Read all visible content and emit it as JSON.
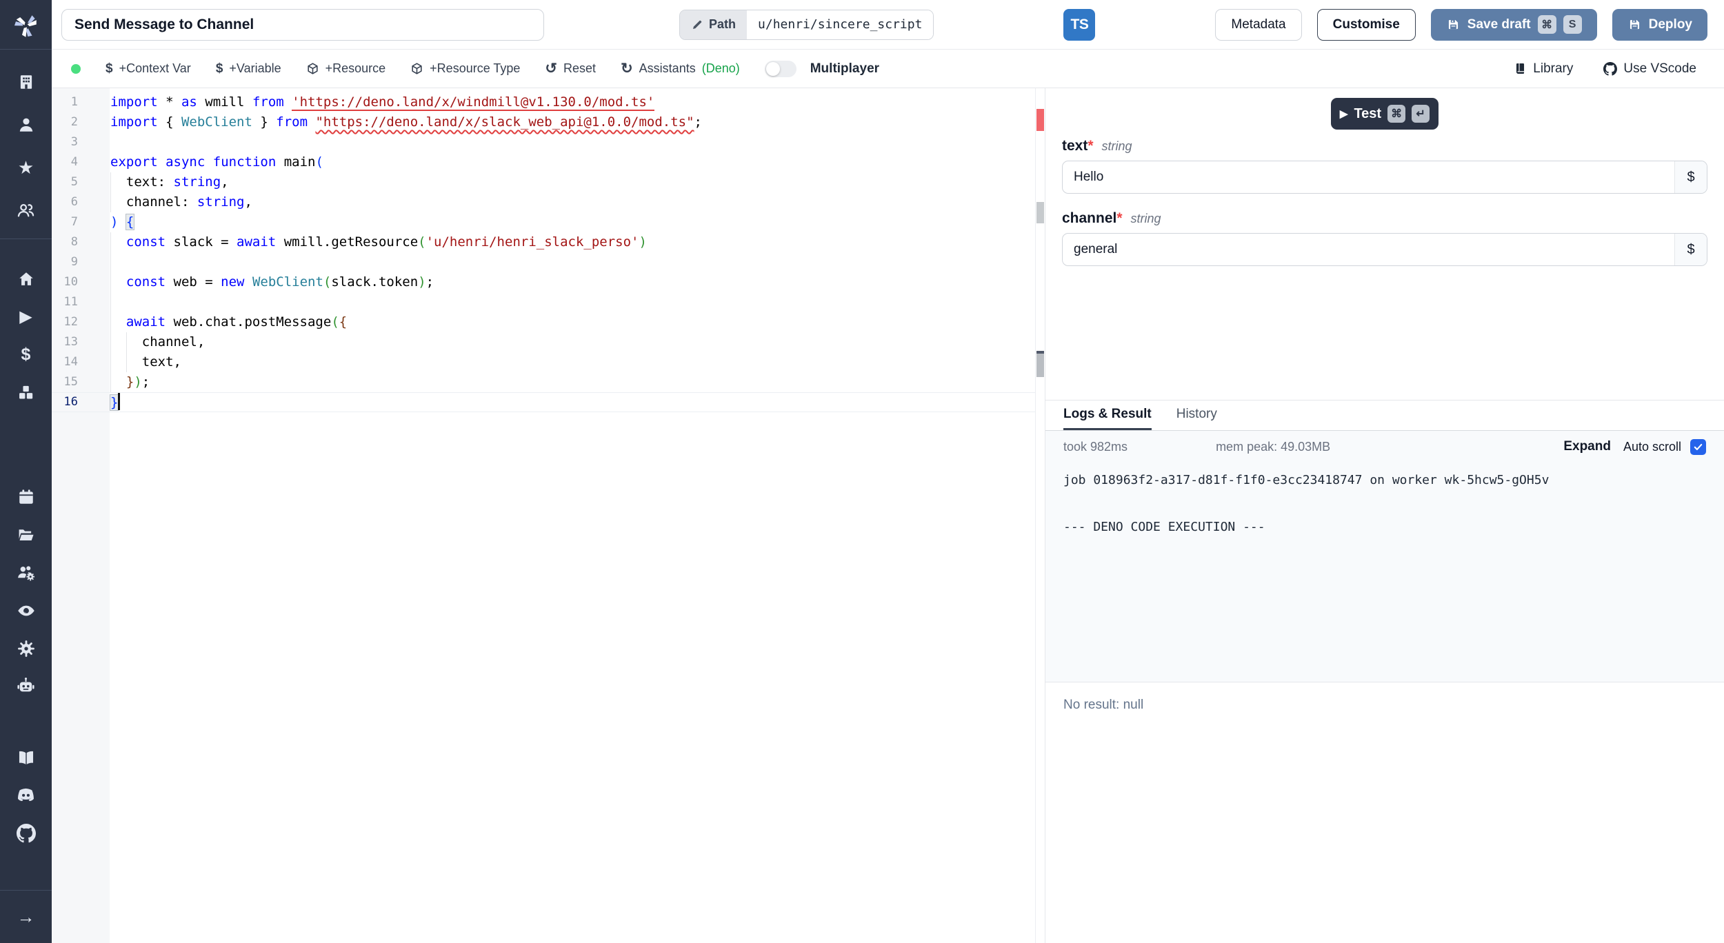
{
  "topbar": {
    "title": "Send Message to Channel",
    "path_label": "Path",
    "path_value": "u/henri/sincere_script",
    "lang_badge": "TS",
    "metadata_label": "Metadata",
    "customise_label": "Customise",
    "save_draft_label": "Save draft",
    "save_shortcut_keys": [
      "⌘",
      "S"
    ],
    "deploy_label": "Deploy"
  },
  "toolbar": {
    "items": [
      {
        "icon": "dollar-icon",
        "glyph": "$",
        "label": "+Context Var"
      },
      {
        "icon": "dollar-icon",
        "glyph": "$",
        "label": "+Variable"
      },
      {
        "icon": "cube-icon",
        "label": "+Resource"
      },
      {
        "icon": "cube-icon",
        "label": "+Resource Type"
      },
      {
        "icon": "reset-icon",
        "glyph": "↺",
        "label": "Reset"
      },
      {
        "icon": "refresh-icon",
        "glyph": "↻",
        "label": "Assistants",
        "suffix": "(Deno)"
      }
    ],
    "multiplayer_label": "Multiplayer",
    "library_label": "Library",
    "vscode_label": "Use VScode"
  },
  "editor": {
    "lines": [
      {
        "num": 1,
        "tokens": [
          [
            "kw",
            "import"
          ],
          [
            "pl",
            " * "
          ],
          [
            "kw",
            "as"
          ],
          [
            "pl",
            " wmill "
          ],
          [
            "kw",
            "from"
          ],
          [
            "pl",
            " "
          ],
          [
            "str errline",
            "'https://deno.land/x/windmill@v1.130.0/mod.ts'"
          ]
        ]
      },
      {
        "num": 2,
        "tokens": [
          [
            "kw",
            "import"
          ],
          [
            "pl",
            " { "
          ],
          [
            "type",
            "WebClient"
          ],
          [
            "pl",
            " } "
          ],
          [
            "kw",
            "from"
          ],
          [
            "pl",
            " "
          ],
          [
            "str errwavy",
            "\"https://deno.land/x/slack_web_api@1.0.0/mod.ts\""
          ],
          [
            "pl",
            ";"
          ]
        ]
      },
      {
        "num": 3,
        "tokens": []
      },
      {
        "num": 4,
        "tokens": [
          [
            "kw",
            "export"
          ],
          [
            "pl",
            " "
          ],
          [
            "kw",
            "async"
          ],
          [
            "pl",
            " "
          ],
          [
            "kw",
            "function"
          ],
          [
            "pl",
            " main"
          ],
          [
            "b1",
            "("
          ]
        ]
      },
      {
        "num": 5,
        "guide": true,
        "tokens": [
          [
            "pl",
            "  text: "
          ],
          [
            "kw",
            "string"
          ],
          [
            "pl",
            ","
          ]
        ]
      },
      {
        "num": 6,
        "guide": true,
        "tokens": [
          [
            "pl",
            "  channel: "
          ],
          [
            "kw",
            "string"
          ],
          [
            "pl",
            ","
          ]
        ]
      },
      {
        "num": 7,
        "tokens": [
          [
            "b1",
            ")"
          ],
          [
            "pl",
            " "
          ],
          [
            "b1 match",
            "{"
          ]
        ]
      },
      {
        "num": 8,
        "guide": true,
        "tokens": [
          [
            "pl",
            "  "
          ],
          [
            "kw",
            "const"
          ],
          [
            "pl",
            " slack = "
          ],
          [
            "kw",
            "await"
          ],
          [
            "pl",
            " wmill.getResource"
          ],
          [
            "b2",
            "("
          ],
          [
            "str",
            "'u/henri/henri_slack_perso'"
          ],
          [
            "b2",
            ")"
          ]
        ]
      },
      {
        "num": 9,
        "guide": true,
        "tokens": []
      },
      {
        "num": 10,
        "guide": true,
        "tokens": [
          [
            "pl",
            "  "
          ],
          [
            "kw",
            "const"
          ],
          [
            "pl",
            " web = "
          ],
          [
            "kw",
            "new"
          ],
          [
            "pl",
            " "
          ],
          [
            "type",
            "WebClient"
          ],
          [
            "b2",
            "("
          ],
          [
            "pl",
            "slack.token"
          ],
          [
            "b2",
            ")"
          ],
          [
            "pl",
            ";"
          ]
        ]
      },
      {
        "num": 11,
        "guide": true,
        "tokens": []
      },
      {
        "num": 12,
        "guide": true,
        "tokens": [
          [
            "pl",
            "  "
          ],
          [
            "kw",
            "await"
          ],
          [
            "pl",
            " web.chat.postMessage"
          ],
          [
            "b2",
            "("
          ],
          [
            "b3",
            "{"
          ]
        ]
      },
      {
        "num": 13,
        "guide": true,
        "guide2": true,
        "tokens": [
          [
            "pl",
            "    channel,"
          ]
        ]
      },
      {
        "num": 14,
        "guide": true,
        "guide2": true,
        "tokens": [
          [
            "pl",
            "    text,"
          ]
        ]
      },
      {
        "num": 15,
        "guide": true,
        "tokens": [
          [
            "pl",
            "  "
          ],
          [
            "b3",
            "}"
          ],
          [
            "b2",
            ")"
          ],
          [
            "pl",
            ";"
          ]
        ]
      },
      {
        "num": 16,
        "current": true,
        "cursor": true,
        "tokens": [
          [
            "b1 match",
            "}"
          ]
        ]
      }
    ]
  },
  "form": {
    "test_label": "Test",
    "test_shortcut_keys": [
      "⌘",
      "↵"
    ],
    "fields": [
      {
        "label": "text",
        "required": "*",
        "type": "string",
        "value": "Hello",
        "suffix": "$"
      },
      {
        "label": "channel",
        "required": "*",
        "type": "string",
        "value": "general",
        "suffix": "$"
      }
    ]
  },
  "logs": {
    "tabs": [
      {
        "label": "Logs & Result"
      },
      {
        "label": "History"
      }
    ],
    "active_tab": "Logs & Result",
    "took": "took 982ms",
    "mem": "mem peak: 49.03MB",
    "expand_label": "Expand",
    "autoscroll_label": "Auto scroll",
    "autoscroll_checked": true,
    "lines": [
      "job 018963f2-a317-d81f-f1f0-e3cc23418747 on worker wk-5hcw5-gOH5v",
      "--- DENO CODE EXECUTION ---"
    ],
    "result": "No result: null"
  },
  "sidebar": {
    "icons": [
      "windmill-logo",
      "building",
      "user",
      "star",
      "users",
      "home",
      "play",
      "dollar",
      "cubes",
      "calendar",
      "folder",
      "users-gear",
      "eye",
      "gear",
      "robot",
      "book",
      "discord",
      "github",
      "arrow-right"
    ]
  },
  "colors": {
    "sidebar_bg": "#2b3344",
    "primary_button": "#5e7ea7",
    "ts_badge_blue": "#3178c6",
    "status_green": "#4ade80",
    "deno_green": "#16a34a",
    "error_red": "#e03e3e",
    "checkbox_blue": "#2563eb"
  }
}
